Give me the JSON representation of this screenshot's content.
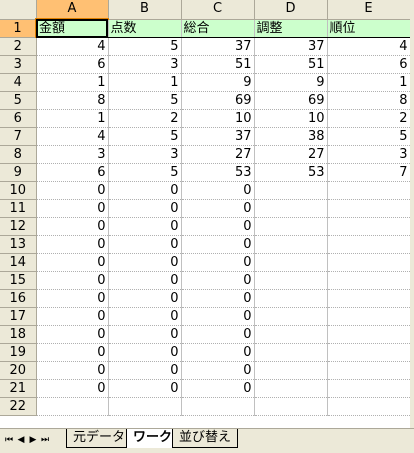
{
  "columns": [
    "A",
    "B",
    "C",
    "D",
    "E"
  ],
  "header_row": [
    "金額",
    "点数",
    "総合",
    "調整",
    "順位"
  ],
  "rows": [
    [
      "2",
      "4",
      "5",
      "37",
      "37",
      "4"
    ],
    [
      "3",
      "6",
      "3",
      "51",
      "51",
      "6"
    ],
    [
      "4",
      "1",
      "1",
      "9",
      "9",
      "1"
    ],
    [
      "5",
      "8",
      "5",
      "69",
      "69",
      "8"
    ],
    [
      "6",
      "1",
      "2",
      "10",
      "10",
      "2"
    ],
    [
      "7",
      "4",
      "5",
      "37",
      "38",
      "5"
    ],
    [
      "8",
      "3",
      "3",
      "27",
      "27",
      "3"
    ],
    [
      "9",
      "6",
      "5",
      "53",
      "53",
      "7"
    ],
    [
      "10",
      "0",
      "0",
      "0",
      "",
      ""
    ],
    [
      "11",
      "0",
      "0",
      "0",
      "",
      ""
    ],
    [
      "12",
      "0",
      "0",
      "0",
      "",
      ""
    ],
    [
      "13",
      "0",
      "0",
      "0",
      "",
      ""
    ],
    [
      "14",
      "0",
      "0",
      "0",
      "",
      ""
    ],
    [
      "15",
      "0",
      "0",
      "0",
      "",
      ""
    ],
    [
      "16",
      "0",
      "0",
      "0",
      "",
      ""
    ],
    [
      "17",
      "0",
      "0",
      "0",
      "",
      ""
    ],
    [
      "18",
      "0",
      "0",
      "0",
      "",
      ""
    ],
    [
      "19",
      "0",
      "0",
      "0",
      "",
      ""
    ],
    [
      "20",
      "0",
      "0",
      "0",
      "",
      ""
    ],
    [
      "21",
      "0",
      "0",
      "0",
      "",
      ""
    ],
    [
      "22",
      "",
      "",
      "",
      "",
      ""
    ]
  ],
  "header_row_number": "1",
  "tabs": [
    "元データ",
    "ワーク",
    "並び替え"
  ],
  "active_tab": 1,
  "nav": {
    "first": "⏮",
    "prev": "◀",
    "next": "▶",
    "last": "⏭"
  },
  "colors": {
    "header_fill": "#ccffcc",
    "active_header": "#ffc073"
  }
}
